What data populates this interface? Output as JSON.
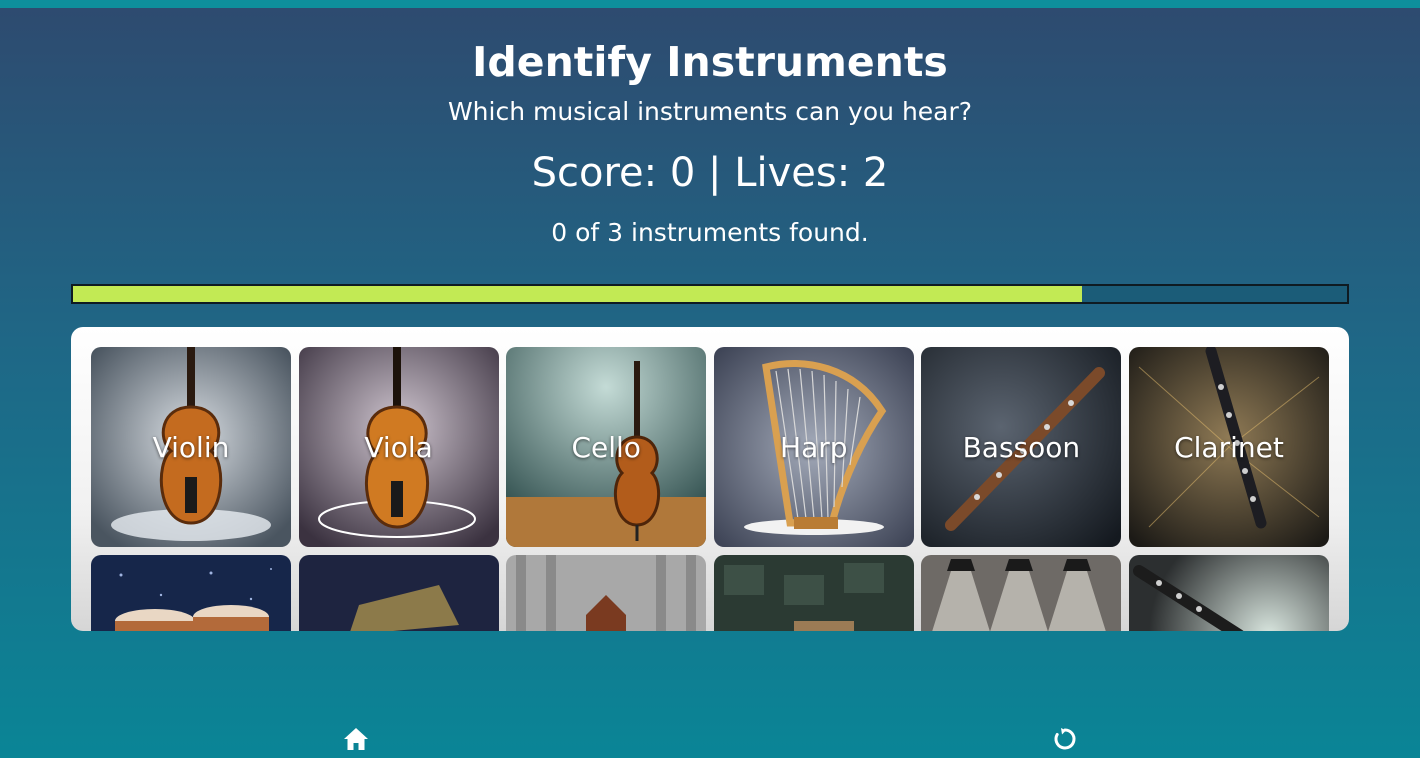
{
  "header": {
    "title": "Identify Instruments",
    "subtitle": "Which musical instruments can you hear?",
    "score_text": "Score: 0 | Lives: 2",
    "found_text": "0 of 3 instruments found."
  },
  "progress": {
    "fraction": 0.792,
    "fill_color": "#c2ea54"
  },
  "instruments": [
    {
      "label": "Violin"
    },
    {
      "label": "Viola"
    },
    {
      "label": "Cello"
    },
    {
      "label": "Harp"
    },
    {
      "label": "Bassoon"
    },
    {
      "label": "Clarinet"
    },
    {
      "label": ""
    },
    {
      "label": ""
    },
    {
      "label": ""
    },
    {
      "label": ""
    },
    {
      "label": ""
    },
    {
      "label": ""
    }
  ],
  "nav": {
    "home_icon": "home-icon",
    "restart_icon": "restart-icon"
  }
}
